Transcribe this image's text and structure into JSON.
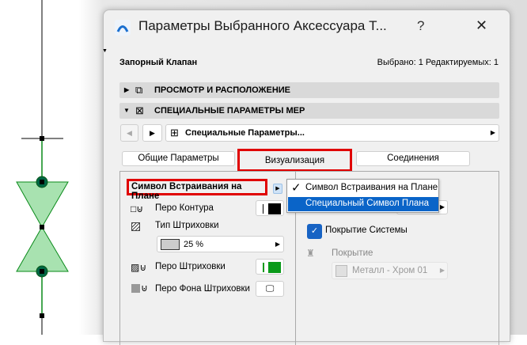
{
  "dialog": {
    "title": "Параметры Выбранного Аксессуара Т...",
    "help": "?",
    "close": "✕"
  },
  "header": {
    "element_name": "Запорный Клапан",
    "selection": "Выбрано: 1 Редактируемых: 1"
  },
  "sections": [
    {
      "label": "ПРОСМОТР И РАСПОЛОЖЕНИЕ",
      "expanded": false
    },
    {
      "label": "СПЕЦИАЛЬНЫЕ ПАРАМЕТРЫ MEP",
      "expanded": true
    }
  ],
  "nav": {
    "page": "Специальные Параметры..."
  },
  "tabs": [
    "Общие Параметры",
    "Визуализация",
    "Соединения"
  ],
  "left": {
    "symbol_select": "Символ Встраивания на Плане",
    "contour_pen": "Перо Контура",
    "hatch_type": "Тип Штриховки",
    "hatch_value": "25 %",
    "hatch_pen": "Перо Штриховки",
    "hatch_bg_pen": "Перо Фона Штриховки"
  },
  "dropdown": {
    "options": [
      "Символ Встраивания на Плане",
      "Специальный Символ Плана"
    ],
    "selected": 0,
    "highlighted": 1
  },
  "right": {
    "system_surface": "Покрытие Системы",
    "system_surface_checked": true,
    "surface_label": "Покрытие",
    "surface_value": "Металл - Хром 01"
  },
  "colors": {
    "contour": "#000000",
    "hatch_pen": "#0a9a1a",
    "highlight": "#0a64c8",
    "accent": "#e00000"
  }
}
